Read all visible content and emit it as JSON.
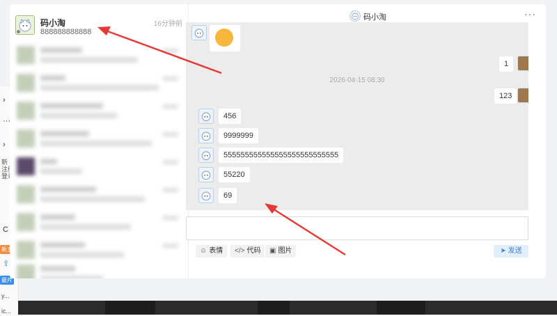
{
  "contact_list": {
    "active": {
      "name": "码小淘",
      "last_message": "888888888888",
      "time": "16分钟前"
    }
  },
  "chat": {
    "title": "码小淘",
    "more_icon": "more-dots-icon",
    "timestamp": "2026-04-15 08:30",
    "messages": [
      {
        "side": "left",
        "kind": "sticker"
      },
      {
        "side": "right",
        "text": "1"
      },
      {
        "side": "right",
        "text": "123"
      },
      {
        "side": "left",
        "text": "456"
      },
      {
        "side": "left",
        "text": "9999999"
      },
      {
        "side": "left",
        "text": "555555555555555555555555555"
      },
      {
        "side": "left",
        "text": "55220"
      },
      {
        "side": "left",
        "text": "69"
      }
    ]
  },
  "toolbar": {
    "emoji_label": "表情",
    "code_label": "代码",
    "image_label": "图片",
    "send_label": "发送"
  },
  "side_panel": {
    "texts": [
      "新",
      "注册",
      "登录",
      "新主",
      "最片",
      "y...",
      "ic..."
    ]
  },
  "colors": {
    "send_text": "#3d7fd6",
    "send_bg": "#e3eefb",
    "arrow": "#e53935"
  }
}
